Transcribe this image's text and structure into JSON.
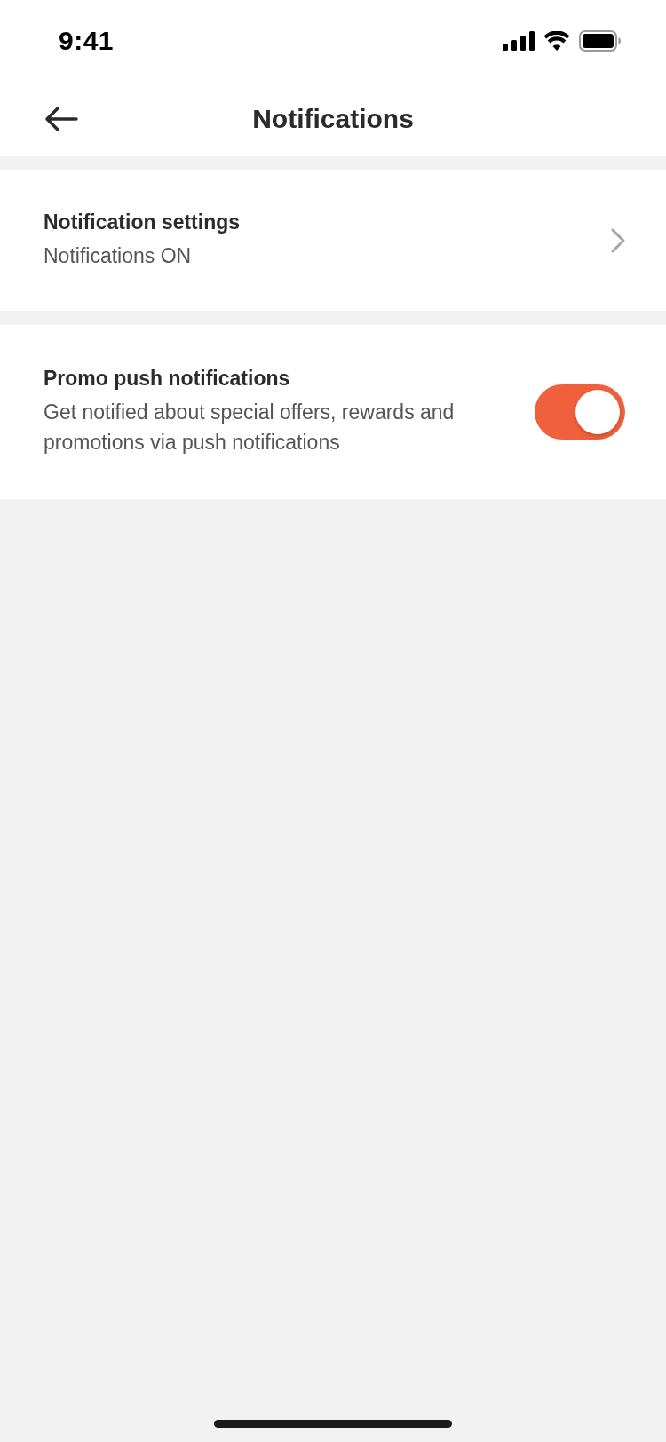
{
  "status_bar": {
    "time": "9:41"
  },
  "header": {
    "title": "Notifications"
  },
  "rows": [
    {
      "kind": "link",
      "title": "Notification settings",
      "subtitle": "Notifications ON"
    },
    {
      "kind": "toggle",
      "title": "Promo push notifications",
      "subtitle": "Get notified about special offers, rewards and promotions via push notifications",
      "on": true
    }
  ]
}
